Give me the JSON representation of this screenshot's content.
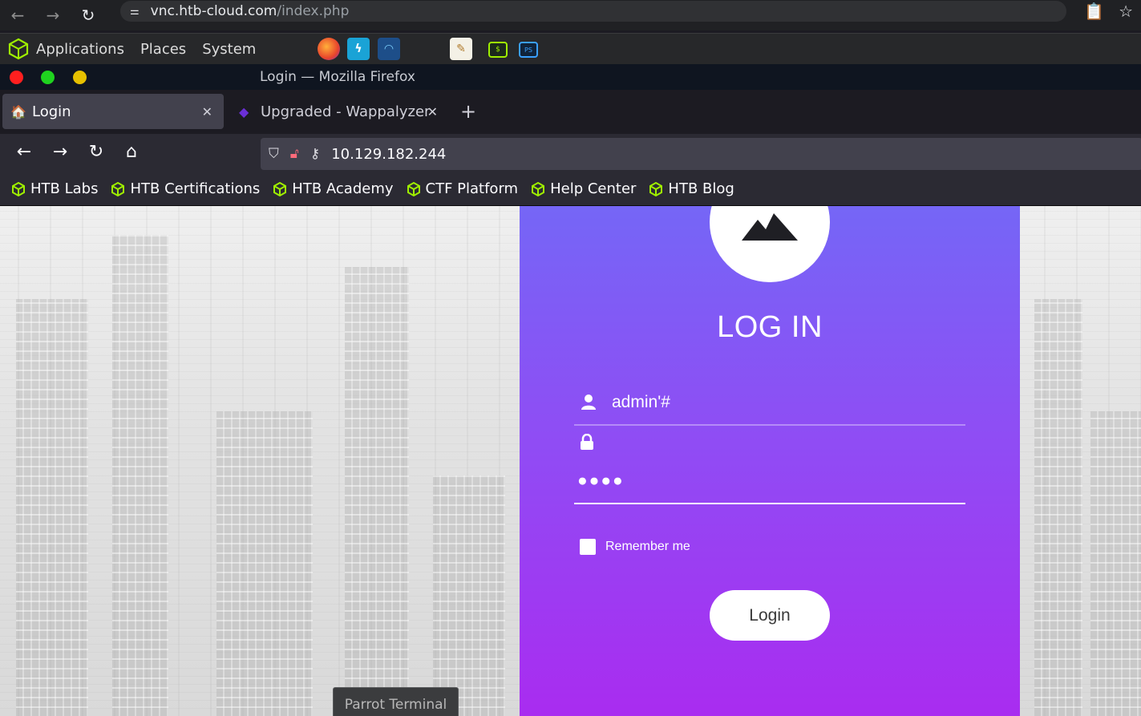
{
  "outer_browser": {
    "url_host": "vnc.htb-cloud.com",
    "url_path": "/index.php"
  },
  "desktop_panel": {
    "menus": [
      "Applications",
      "Places",
      "System"
    ]
  },
  "window": {
    "title": "Login — Mozilla Firefox"
  },
  "tabs": [
    {
      "label": "Login",
      "active": true
    },
    {
      "label": "Upgraded - Wappalyzer",
      "active": false
    }
  ],
  "address_bar": {
    "url": "10.129.182.244"
  },
  "bookmarks": [
    "HTB Labs",
    "HTB Certifications",
    "HTB Academy",
    "CTF Platform",
    "Help Center",
    "HTB Blog"
  ],
  "login_form": {
    "heading": "LOG IN",
    "username_value": "admin'#",
    "password_value": "●●●●",
    "remember_label": "Remember me",
    "remember_checked": false,
    "submit_label": "Login"
  },
  "taskbar": {
    "items": [
      "Parrot Terminal"
    ]
  },
  "colors": {
    "card_top": "#7566f6",
    "card_bottom": "#a92cf0",
    "htb_green": "#9fef00"
  }
}
